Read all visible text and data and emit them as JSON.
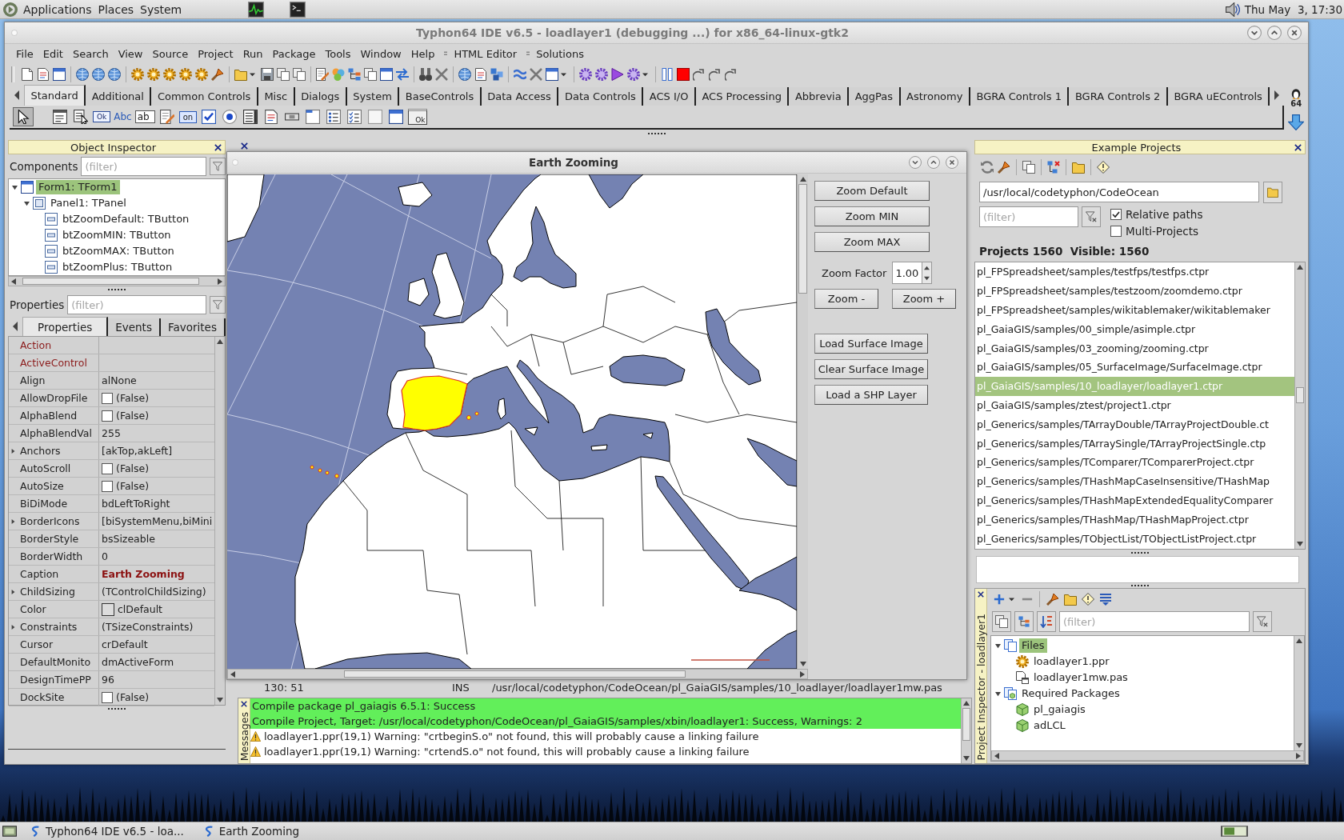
{
  "top_panel": {
    "menus": [
      "Applications",
      "Places",
      "System"
    ],
    "clock": "Thu May  3, 17:30"
  },
  "ide": {
    "title": "Typhon64 IDE v6.5 - loadlayer1 (debugging ...) for x86_64-linux-gtk2",
    "menu": [
      {
        "label": "File",
        "kind": "plain"
      },
      {
        "label": "Edit",
        "kind": "plain"
      },
      {
        "label": "Search",
        "kind": "plain"
      },
      {
        "label": "View",
        "kind": "plain"
      },
      {
        "label": "Source",
        "kind": "plain"
      },
      {
        "label": "Project",
        "kind": "plain"
      },
      {
        "label": "Run",
        "kind": "plain"
      },
      {
        "label": "Package",
        "kind": "plain"
      },
      {
        "label": "Tools",
        "kind": "plain"
      },
      {
        "label": "Window",
        "kind": "plain"
      },
      {
        "label": "Help",
        "kind": "plain"
      },
      {
        "label": "HTML Editor",
        "kind": "addon"
      },
      {
        "label": "Solutions",
        "kind": "addon"
      }
    ],
    "palette_tabs": [
      {
        "label": "Standard",
        "selected": true
      },
      {
        "label": "Additional",
        "selected": false
      },
      {
        "label": "Common Controls",
        "selected": false
      },
      {
        "label": "Misc",
        "selected": false
      },
      {
        "label": "Dialogs",
        "selected": false
      },
      {
        "label": "System",
        "selected": false
      },
      {
        "label": "BaseControls",
        "selected": false
      },
      {
        "label": "Data Access",
        "selected": false
      },
      {
        "label": "Data Controls",
        "selected": false
      },
      {
        "label": "ACS I/O",
        "selected": false
      },
      {
        "label": "ACS Processing",
        "selected": false
      },
      {
        "label": "Abbrevia",
        "selected": false
      },
      {
        "label": "AggPas",
        "selected": false
      },
      {
        "label": "Astronomy",
        "selected": false
      },
      {
        "label": "BGRA Controls 1",
        "selected": false
      },
      {
        "label": "BGRA Controls 2",
        "selected": false
      },
      {
        "label": "BGRA uEControls",
        "selected": false
      }
    ],
    "platform_badge": "64",
    "components": [
      {
        "kind": "pointer",
        "selected": true
      },
      {
        "kind": "main-menu",
        "selected": false
      },
      {
        "kind": "popup-menu",
        "selected": false
      },
      {
        "kind": "button",
        "text": "Ok",
        "selected": false
      },
      {
        "kind": "label",
        "text": "Abc",
        "selected": false
      },
      {
        "kind": "edit",
        "text": "ab",
        "selected": false
      },
      {
        "kind": "memo",
        "selected": false
      },
      {
        "kind": "toggle",
        "text": "on",
        "selected": false
      },
      {
        "kind": "checkbox",
        "selected": false
      },
      {
        "kind": "radio",
        "selected": false
      },
      {
        "kind": "listbox",
        "selected": false
      },
      {
        "kind": "combobox",
        "selected": false
      },
      {
        "kind": "scrollbar",
        "selected": false
      },
      {
        "kind": "groupbox",
        "selected": false
      },
      {
        "kind": "radiogroup",
        "selected": false
      },
      {
        "kind": "checkgroup",
        "selected": false
      },
      {
        "kind": "panel",
        "selected": false
      },
      {
        "kind": "frame",
        "selected": false
      },
      {
        "kind": "button-panel",
        "text": "Ok",
        "selected": false
      }
    ]
  },
  "object_inspector": {
    "title": "Object Inspector",
    "components_label": "Components",
    "components_filter": {
      "placeholder": "(filter)"
    },
    "tree": [
      {
        "label": "Form1: TForm1",
        "kind": "form",
        "selected": true,
        "expanded": true,
        "children": [
          {
            "label": "Panel1: TPanel",
            "kind": "panel",
            "selected": false,
            "expanded": true,
            "children": [
              {
                "label": "btZoomDefault: TButton",
                "kind": "button",
                "selected": false
              },
              {
                "label": "btZoomMIN: TButton",
                "kind": "button",
                "selected": false
              },
              {
                "label": "btZoomMAX: TButton",
                "kind": "button",
                "selected": false
              },
              {
                "label": "btZoomPlus: TButton",
                "kind": "button",
                "selected": false
              }
            ]
          }
        ]
      }
    ],
    "properties_label": "Properties",
    "properties_filter": {
      "placeholder": "(filter)"
    },
    "tabs": [
      {
        "label": "Properties",
        "selected": true
      },
      {
        "label": "Events",
        "selected": false
      },
      {
        "label": "Favorites",
        "selected": false
      }
    ],
    "properties": [
      {
        "name": "Action",
        "kind": "link"
      },
      {
        "name": "ActiveControl",
        "kind": "link"
      },
      {
        "name": "Align",
        "kind": "text",
        "value": "alNone"
      },
      {
        "name": "AllowDropFile",
        "kind": "checkbox",
        "checked": false,
        "value": "(False)"
      },
      {
        "name": "AlphaBlend",
        "kind": "checkbox",
        "checked": false,
        "value": "(False)"
      },
      {
        "name": "AlphaBlendVal",
        "kind": "text",
        "value": "255"
      },
      {
        "name": "Anchors",
        "kind": "set",
        "expanded": false,
        "value": "[akTop,akLeft]"
      },
      {
        "name": "AutoScroll",
        "kind": "checkbox",
        "checked": false,
        "value": "(False)"
      },
      {
        "name": "AutoSize",
        "kind": "checkbox",
        "checked": false,
        "value": "(False)"
      },
      {
        "name": "BiDiMode",
        "kind": "text",
        "value": "bdLeftToRight"
      },
      {
        "name": "BorderIcons",
        "kind": "set",
        "expanded": false,
        "value": "[biSystemMenu,biMini"
      },
      {
        "name": "BorderStyle",
        "kind": "text",
        "value": "bsSizeable"
      },
      {
        "name": "BorderWidth",
        "kind": "text",
        "value": "0"
      },
      {
        "name": "Caption",
        "kind": "modified",
        "value": "Earth Zooming"
      },
      {
        "name": "ChildSizing",
        "kind": "set",
        "expanded": false,
        "value": "(TControlChildSizing)"
      },
      {
        "name": "Color",
        "kind": "color",
        "value": "clDefault"
      },
      {
        "name": "Constraints",
        "kind": "set",
        "expanded": false,
        "value": "(TSizeConstraints)"
      },
      {
        "name": "Cursor",
        "kind": "text",
        "value": "crDefault"
      },
      {
        "name": "DefaultMonito",
        "kind": "text",
        "value": "dmActiveForm"
      },
      {
        "name": "DesignTimePP",
        "kind": "text",
        "value": "96"
      },
      {
        "name": "DockSite",
        "kind": "checkbox",
        "checked": false,
        "value": "(False)"
      }
    ]
  },
  "editor": {
    "position": "130: 51",
    "mode": "INS",
    "file": "/usr/local/codetyphon/CodeOcean/pl_GaiaGIS/samples/10_loadlayer/loadlayer1mw.pas"
  },
  "messages": {
    "title": "Messages",
    "lines": [
      {
        "kind": "success",
        "text": "Compile package pl_gaiagis 6.5.1: Success"
      },
      {
        "kind": "success",
        "text": "Compile Project, Target: /usr/local/codetyphon/CodeOcean/pl_GaiaGIS/samples/xbin/loadlayer1: Success, Warnings: 2"
      },
      {
        "kind": "warning",
        "text": "loadlayer1.ppr(19,1) Warning: \"crtbeginS.o\" not found, this will probably cause a linking failure"
      },
      {
        "kind": "warning",
        "text": "loadlayer1.ppr(19,1) Warning: \"crtendS.o\" not found, this will probably cause a linking failure"
      }
    ]
  },
  "example_projects": {
    "title": "Example Projects",
    "path": "/usr/local/codetyphon/CodeOcean",
    "filter": {
      "placeholder": "(filter)"
    },
    "options": [
      {
        "label": "Relative paths",
        "checked": true
      },
      {
        "label": "Multi-Projects",
        "checked": false
      }
    ],
    "summary": "Projects 1560  Visible: 1560",
    "projects": [
      {
        "label": "pl_FPSpreadsheet/samples/testfps/testfps.ctpr",
        "selected": false
      },
      {
        "label": "pl_FPSpreadsheet/samples/testzoom/zoomdemo.ctpr",
        "selected": false
      },
      {
        "label": "pl_FPSpreadsheet/samples/wikitablemaker/wikitablemaker",
        "selected": false
      },
      {
        "label": "pl_GaiaGIS/samples/00_simple/asimple.ctpr",
        "selected": false
      },
      {
        "label": "pl_GaiaGIS/samples/03_zooming/zooming.ctpr",
        "selected": false
      },
      {
        "label": "pl_GaiaGIS/samples/05_SurfaceImage/SurfaceImage.ctpr",
        "selected": false
      },
      {
        "label": "pl_GaiaGIS/samples/10_loadlayer/loadlayer1.ctpr",
        "selected": true
      },
      {
        "label": "pl_GaiaGIS/samples/ztest/project1.ctpr",
        "selected": false
      },
      {
        "label": "pl_Generics/samples/TArrayDouble/TArrayProjectDouble.ct",
        "selected": false
      },
      {
        "label": "pl_Generics/samples/TArraySingle/TArrayProjectSingle.ctp",
        "selected": false
      },
      {
        "label": "pl_Generics/samples/TComparer/TComparerProject.ctpr",
        "selected": false
      },
      {
        "label": "pl_Generics/samples/THashMapCaseInsensitive/THashMap",
        "selected": false
      },
      {
        "label": "pl_Generics/samples/THashMapExtendedEqualityComparer",
        "selected": false
      },
      {
        "label": "pl_Generics/samples/THashMap/THashMapProject.ctpr",
        "selected": false
      },
      {
        "label": "pl_Generics/samples/TObjectList/TObjectListProject.ctpr",
        "selected": false
      }
    ]
  },
  "project_inspector": {
    "title": "Project Inspector - loadlayer1",
    "filter": {
      "placeholder": "(filter)"
    },
    "tree": [
      {
        "label": "Files",
        "kind": "files",
        "selected": true,
        "expanded": true,
        "children": [
          {
            "label": "loadlayer1.ppr",
            "kind": "project-file",
            "selected": false
          },
          {
            "label": "loadlayer1mw.pas",
            "kind": "unit-file",
            "selected": false
          }
        ]
      },
      {
        "label": "Required Packages",
        "kind": "packages",
        "selected": false,
        "expanded": true,
        "children": [
          {
            "label": "pl_gaiagis",
            "kind": "package",
            "selected": false
          },
          {
            "label": "adLCL",
            "kind": "package",
            "selected": false
          }
        ]
      }
    ]
  },
  "earth_window": {
    "title": "Earth Zooming",
    "zoom_buttons": [
      "Zoom Default",
      "Zoom MIN",
      "Zoom MAX"
    ],
    "zoom_factor_label": "Zoom Factor",
    "zoom_factor": "1.00",
    "step_buttons": [
      "Zoom -",
      "Zoom +"
    ],
    "layer_buttons": [
      "Load Surface Image",
      "Clear Surface Image",
      "Load a SHP Layer"
    ]
  },
  "taskbar": {
    "tasks": [
      "Typhon64 IDE v6.5 - loa...",
      "Earth Zooming"
    ]
  }
}
